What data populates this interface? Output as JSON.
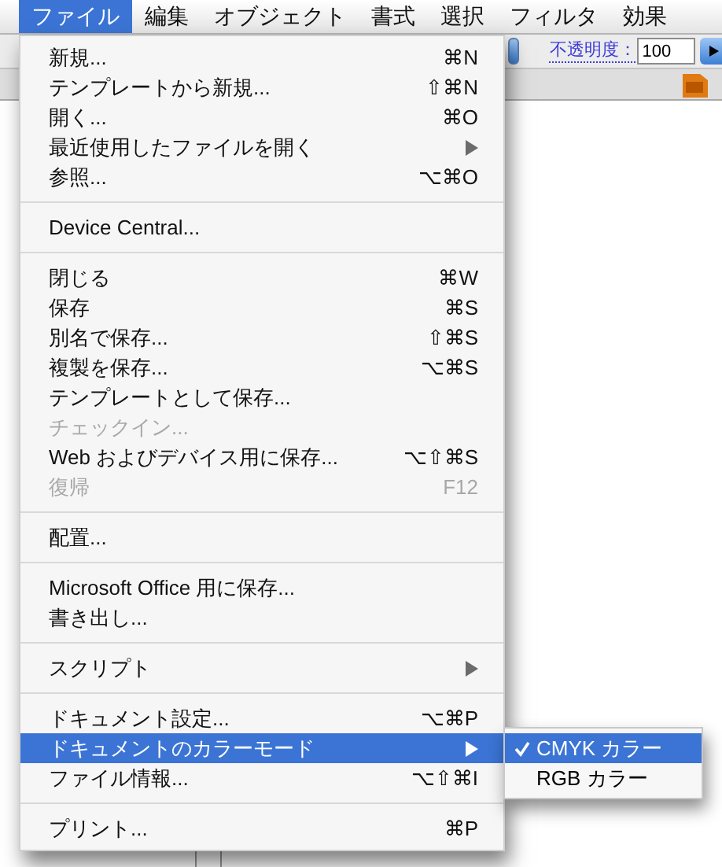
{
  "menubar": [
    {
      "label": "ファイル",
      "selected": true
    },
    {
      "label": "編集",
      "selected": false
    },
    {
      "label": "オブジェクト",
      "selected": false
    },
    {
      "label": "書式",
      "selected": false
    },
    {
      "label": "選択",
      "selected": false
    },
    {
      "label": "フィルタ",
      "selected": false
    },
    {
      "label": "効果",
      "selected": false
    }
  ],
  "toolbar": {
    "opacity_label": "不透明度：",
    "opacity_value": "100"
  },
  "menu": {
    "items": [
      {
        "kind": "item",
        "label": "新規...",
        "shortcut": "⌘N",
        "disabled": false,
        "has_submenu": false,
        "selected": false
      },
      {
        "kind": "item",
        "label": "テンプレートから新規...",
        "shortcut": "⇧⌘N",
        "disabled": false,
        "has_submenu": false,
        "selected": false
      },
      {
        "kind": "item",
        "label": "開く...",
        "shortcut": "⌘O",
        "disabled": false,
        "has_submenu": false,
        "selected": false
      },
      {
        "kind": "item",
        "label": "最近使用したファイルを開く",
        "disabled": false,
        "has_submenu": true,
        "selected": false
      },
      {
        "kind": "item",
        "label": "参照...",
        "shortcut": "⌥⌘O",
        "disabled": false,
        "has_submenu": false,
        "selected": false
      },
      {
        "kind": "separator"
      },
      {
        "kind": "item",
        "label": "Device Central...",
        "disabled": false,
        "has_submenu": false,
        "selected": false
      },
      {
        "kind": "separator"
      },
      {
        "kind": "item",
        "label": "閉じる",
        "shortcut": "⌘W",
        "disabled": false,
        "has_submenu": false,
        "selected": false
      },
      {
        "kind": "item",
        "label": "保存",
        "shortcut": "⌘S",
        "disabled": false,
        "has_submenu": false,
        "selected": false
      },
      {
        "kind": "item",
        "label": "別名で保存...",
        "shortcut": "⇧⌘S",
        "disabled": false,
        "has_submenu": false,
        "selected": false
      },
      {
        "kind": "item",
        "label": "複製を保存...",
        "shortcut": "⌥⌘S",
        "disabled": false,
        "has_submenu": false,
        "selected": false
      },
      {
        "kind": "item",
        "label": "テンプレートとして保存...",
        "disabled": false,
        "has_submenu": false,
        "selected": false
      },
      {
        "kind": "item",
        "label": "チェックイン...",
        "disabled": true,
        "has_submenu": false,
        "selected": false
      },
      {
        "kind": "item",
        "label": "Web およびデバイス用に保存...",
        "shortcut": "⌥⇧⌘S",
        "disabled": false,
        "has_submenu": false,
        "selected": false
      },
      {
        "kind": "item",
        "label": "復帰",
        "shortcut": "F12",
        "disabled": true,
        "has_submenu": false,
        "selected": false
      },
      {
        "kind": "separator"
      },
      {
        "kind": "item",
        "label": "配置...",
        "disabled": false,
        "has_submenu": false,
        "selected": false
      },
      {
        "kind": "separator"
      },
      {
        "kind": "item",
        "label": "Microsoft Office 用に保存...",
        "disabled": false,
        "has_submenu": false,
        "selected": false
      },
      {
        "kind": "item",
        "label": "書き出し...",
        "disabled": false,
        "has_submenu": false,
        "selected": false
      },
      {
        "kind": "separator"
      },
      {
        "kind": "item",
        "label": "スクリプト",
        "disabled": false,
        "has_submenu": true,
        "selected": false
      },
      {
        "kind": "separator"
      },
      {
        "kind": "item",
        "label": "ドキュメント設定...",
        "shortcut": "⌥⌘P",
        "disabled": false,
        "has_submenu": false,
        "selected": false
      },
      {
        "kind": "item",
        "label": "ドキュメントのカラーモード",
        "disabled": false,
        "has_submenu": true,
        "selected": true
      },
      {
        "kind": "item",
        "label": "ファイル情報...",
        "shortcut": "⌥⇧⌘I",
        "disabled": false,
        "has_submenu": false,
        "selected": false
      },
      {
        "kind": "separator"
      },
      {
        "kind": "item",
        "label": "プリント...",
        "shortcut": "⌘P",
        "disabled": false,
        "has_submenu": false,
        "selected": false
      }
    ]
  },
  "submenu": {
    "items": [
      {
        "label": "CMYK カラー",
        "checked": true,
        "selected": true
      },
      {
        "label": "RGB カラー",
        "checked": false,
        "selected": false
      }
    ]
  }
}
